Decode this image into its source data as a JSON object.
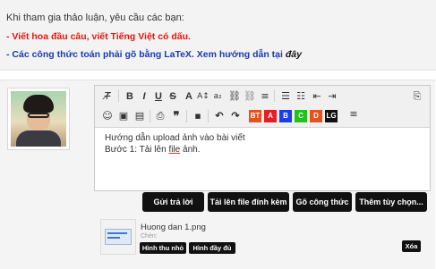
{
  "notice": {
    "intro": "Khi tham gia thảo luận, yêu cầu các bạn:",
    "rule_1": "- Viết hoa đầu câu, viết Tiếng Việt có dấu.",
    "rule_2": "- Các công thức toán phải gõ bằng LaTeX. Xem hướng dẫn tại ",
    "rule_2_link": "đây"
  },
  "toolbar": {
    "row1": {
      "clear_format": "T̸",
      "bold": "B",
      "italic": "I",
      "underline": "U",
      "strike": "S",
      "font_color": "A",
      "font_size": "A↕",
      "subscript": "a₂",
      "link": "⛓",
      "unlink": "⛓",
      "align": "≡",
      "bullets": "☰",
      "numbered": "☷",
      "outdent": "⇤",
      "indent": "⇥",
      "source": "⎘"
    },
    "row2": {
      "smiley": "☺",
      "image": "▣",
      "media": "▤",
      "insert": "⎙",
      "quote": "❞",
      "save": "▪",
      "undo": "↶",
      "redo": "↷",
      "color_btns": [
        {
          "label": "BT",
          "color": "#e8511c"
        },
        {
          "label": "A",
          "color": "#e81c24"
        },
        {
          "label": "B",
          "color": "#1c3ee8"
        },
        {
          "label": "C",
          "color": "#1ec41c"
        },
        {
          "label": "D",
          "color": "#e8511c"
        },
        {
          "label": "LG",
          "color": "#111111"
        }
      ],
      "align": "≡"
    }
  },
  "editor_content": {
    "line_1": "Hướng dẫn upload ảnh vào bài viết",
    "line_2_prefix": "Bước 1: Tải lên ",
    "line_2_file": "file",
    "line_2_suffix": " ảnh."
  },
  "actions": {
    "submit": "Gửi trả lời",
    "upload": "Tải lên file đính kèm",
    "formula": "Gõ công thức",
    "more": "Thêm tùy chọn..."
  },
  "attachment": {
    "name": "Huong dan 1.png",
    "sub": "Chèn:",
    "thumb_btn": "Hình thu nhỏ",
    "full_btn": "Hình đầy đủ",
    "delete_btn": "Xóa"
  }
}
